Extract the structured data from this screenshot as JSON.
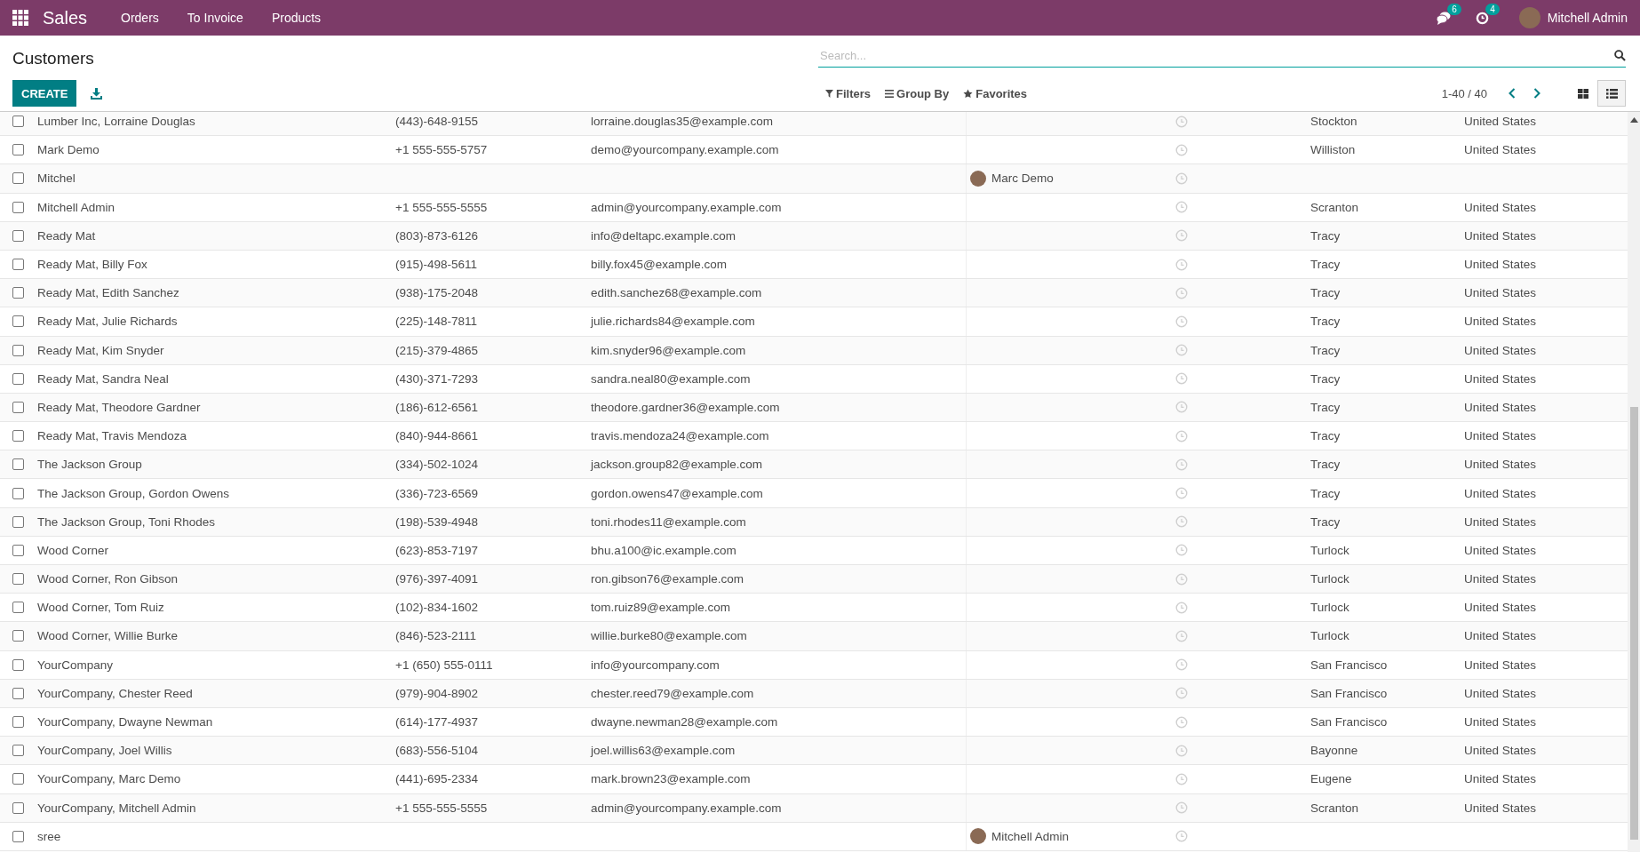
{
  "navbar": {
    "app_name": "Sales",
    "menu": [
      "Orders",
      "To Invoice",
      "Products"
    ],
    "messages_count": "6",
    "activities_count": "4",
    "user": "Mitchell Admin"
  },
  "control_panel": {
    "title": "Customers",
    "create_button": "CREATE",
    "search": {
      "placeholder": "Search..."
    },
    "filters": [
      "Filters",
      "Group By",
      "Favorites"
    ],
    "pager": "1-40 / 40",
    "views": [
      {
        "kind": "kanban",
        "selected": false
      },
      {
        "kind": "list",
        "selected": true
      }
    ]
  },
  "rows": [
    {
      "name": "Lumber Inc, Lorraine Douglas",
      "phone": "(443)-648-9155",
      "email": "lorraine.douglas35@example.com",
      "salesperson": "",
      "city": "Stockton",
      "country": "United States",
      "checked": false
    },
    {
      "name": "Mark Demo",
      "phone": "+1 555-555-5757",
      "email": "demo@yourcompany.example.com",
      "salesperson": "",
      "city": "Williston",
      "country": "United States",
      "checked": false
    },
    {
      "name": "Mitchel",
      "phone": "",
      "email": "",
      "salesperson": "Marc Demo",
      "city": "",
      "country": "",
      "checked": false
    },
    {
      "name": "Mitchell Admin",
      "phone": "+1 555-555-5555",
      "email": "admin@yourcompany.example.com",
      "salesperson": "",
      "city": "Scranton",
      "country": "United States",
      "checked": false
    },
    {
      "name": "Ready Mat",
      "phone": "(803)-873-6126",
      "email": "info@deltapc.example.com",
      "salesperson": "",
      "city": "Tracy",
      "country": "United States",
      "checked": false
    },
    {
      "name": "Ready Mat, Billy Fox",
      "phone": "(915)-498-5611",
      "email": "billy.fox45@example.com",
      "salesperson": "",
      "city": "Tracy",
      "country": "United States",
      "checked": false
    },
    {
      "name": "Ready Mat, Edith Sanchez",
      "phone": "(938)-175-2048",
      "email": "edith.sanchez68@example.com",
      "salesperson": "",
      "city": "Tracy",
      "country": "United States",
      "checked": false
    },
    {
      "name": "Ready Mat, Julie Richards",
      "phone": "(225)-148-7811",
      "email": "julie.richards84@example.com",
      "salesperson": "",
      "city": "Tracy",
      "country": "United States",
      "checked": false
    },
    {
      "name": "Ready Mat, Kim Snyder",
      "phone": "(215)-379-4865",
      "email": "kim.snyder96@example.com",
      "salesperson": "",
      "city": "Tracy",
      "country": "United States",
      "checked": false
    },
    {
      "name": "Ready Mat, Sandra Neal",
      "phone": "(430)-371-7293",
      "email": "sandra.neal80@example.com",
      "salesperson": "",
      "city": "Tracy",
      "country": "United States",
      "checked": false
    },
    {
      "name": "Ready Mat, Theodore Gardner",
      "phone": "(186)-612-6561",
      "email": "theodore.gardner36@example.com",
      "salesperson": "",
      "city": "Tracy",
      "country": "United States",
      "checked": false
    },
    {
      "name": "Ready Mat, Travis Mendoza",
      "phone": "(840)-944-8661",
      "email": "travis.mendoza24@example.com",
      "salesperson": "",
      "city": "Tracy",
      "country": "United States",
      "checked": false
    },
    {
      "name": "The Jackson Group",
      "phone": "(334)-502-1024",
      "email": "jackson.group82@example.com",
      "salesperson": "",
      "city": "Tracy",
      "country": "United States",
      "checked": false
    },
    {
      "name": "The Jackson Group, Gordon Owens",
      "phone": "(336)-723-6569",
      "email": "gordon.owens47@example.com",
      "salesperson": "",
      "city": "Tracy",
      "country": "United States",
      "checked": false
    },
    {
      "name": "The Jackson Group, Toni Rhodes",
      "phone": "(198)-539-4948",
      "email": "toni.rhodes11@example.com",
      "salesperson": "",
      "city": "Tracy",
      "country": "United States",
      "checked": false
    },
    {
      "name": "Wood Corner",
      "phone": "(623)-853-7197",
      "email": "bhu.a100@ic.example.com",
      "salesperson": "",
      "city": "Turlock",
      "country": "United States",
      "checked": false
    },
    {
      "name": "Wood Corner, Ron Gibson",
      "phone": "(976)-397-4091",
      "email": "ron.gibson76@example.com",
      "salesperson": "",
      "city": "Turlock",
      "country": "United States",
      "checked": false
    },
    {
      "name": "Wood Corner, Tom Ruiz",
      "phone": "(102)-834-1602",
      "email": "tom.ruiz89@example.com",
      "salesperson": "",
      "city": "Turlock",
      "country": "United States",
      "checked": false
    },
    {
      "name": "Wood Corner, Willie Burke",
      "phone": "(846)-523-2111",
      "email": "willie.burke80@example.com",
      "salesperson": "",
      "city": "Turlock",
      "country": "United States",
      "checked": false
    },
    {
      "name": "YourCompany",
      "phone": "+1 (650) 555-0111",
      "email": "info@yourcompany.com",
      "salesperson": "",
      "city": "San Francisco",
      "country": "United States",
      "checked": false
    },
    {
      "name": "YourCompany, Chester Reed",
      "phone": "(979)-904-8902",
      "email": "chester.reed79@example.com",
      "salesperson": "",
      "city": "San Francisco",
      "country": "United States",
      "checked": false
    },
    {
      "name": "YourCompany, Dwayne Newman",
      "phone": "(614)-177-4937",
      "email": "dwayne.newman28@example.com",
      "salesperson": "",
      "city": "San Francisco",
      "country": "United States",
      "checked": false
    },
    {
      "name": "YourCompany, Joel Willis",
      "phone": "(683)-556-5104",
      "email": "joel.willis63@example.com",
      "salesperson": "",
      "city": "Bayonne",
      "country": "United States",
      "checked": false
    },
    {
      "name": "YourCompany, Marc Demo",
      "phone": "(441)-695-2334",
      "email": "mark.brown23@example.com",
      "salesperson": "",
      "city": "Eugene",
      "country": "United States",
      "checked": false
    },
    {
      "name": "YourCompany, Mitchell Admin",
      "phone": "+1 555-555-5555",
      "email": "admin@yourcompany.example.com",
      "salesperson": "",
      "city": "Scranton",
      "country": "United States",
      "checked": false
    },
    {
      "name": "sree",
      "phone": "",
      "email": "",
      "salesperson": "Mitchell Admin",
      "city": "",
      "country": "",
      "checked": false
    }
  ]
}
